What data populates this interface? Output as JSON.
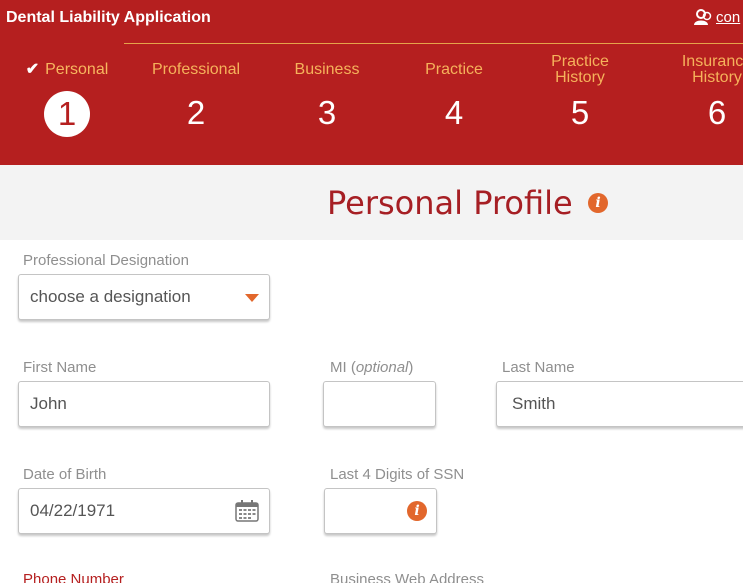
{
  "app": {
    "title": "Dental Liability Application",
    "user_link": "con"
  },
  "steps": [
    {
      "label": "Personal",
      "number": "1",
      "active": true,
      "completed": true
    },
    {
      "label": "Professional",
      "number": "2",
      "active": false
    },
    {
      "label": "Business",
      "number": "3",
      "active": false
    },
    {
      "label": "Practice",
      "number": "4",
      "active": false
    },
    {
      "label": "Practice History",
      "number": "5",
      "active": false
    },
    {
      "label": "Insurance History",
      "number": "6",
      "active": false
    }
  ],
  "page": {
    "title": "Personal Profile",
    "info_glyph": "i"
  },
  "form": {
    "designation": {
      "label": "Professional Designation",
      "value": "choose a designation"
    },
    "first_name": {
      "label": "First Name",
      "value": "John"
    },
    "mi": {
      "label": "MI",
      "label_suffix": "(optional)",
      "value": ""
    },
    "last_name": {
      "label": "Last Name",
      "value": "Smith"
    },
    "dob": {
      "label": "Date of Birth",
      "value": "04/22/1971"
    },
    "ssn": {
      "label": "Last 4 Digits of SSN",
      "value": ""
    },
    "phone": {
      "label": "Phone Number"
    },
    "web": {
      "label": "Business Web Address"
    }
  },
  "colors": {
    "header_bg": "#b51f1f",
    "step_label": "#f5b25b",
    "title": "#a61f24",
    "accent": "#e2672c"
  }
}
